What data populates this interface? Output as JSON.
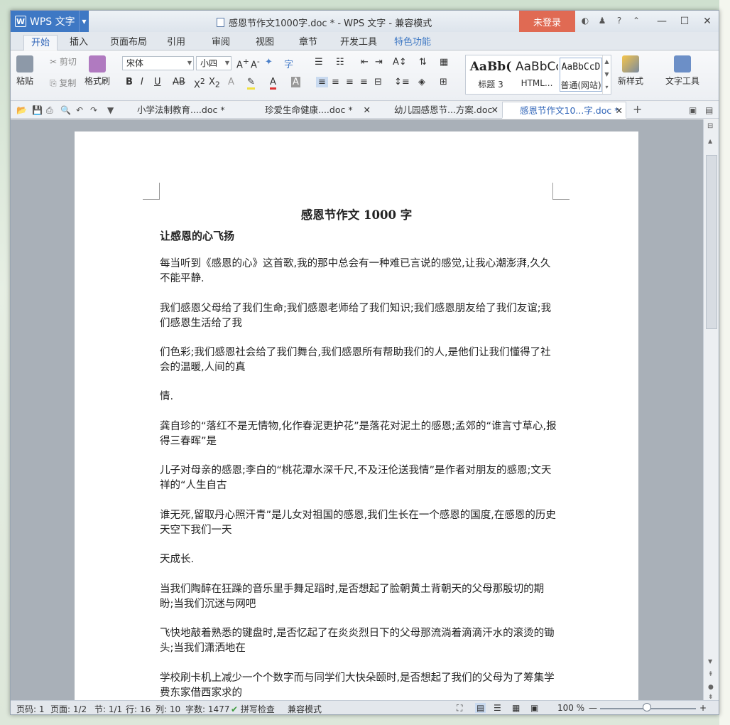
{
  "titlebar": {
    "app_name": "WPS 文字",
    "title": "感恩节作文1000字.doc * - WPS 文字 - 兼容模式",
    "login_label": "未登录"
  },
  "menu_tabs": [
    "开始",
    "插入",
    "页面布局",
    "引用",
    "审阅",
    "视图",
    "章节",
    "开发工具",
    "特色功能"
  ],
  "ribbon": {
    "paste": "粘贴",
    "cut": "剪切",
    "copy": "复制",
    "format_painter": "格式刷",
    "font_name": "宋体",
    "font_size": "小四",
    "styles": [
      {
        "preview": "AaBb(",
        "label": "标题 3"
      },
      {
        "preview": "AaBbCc",
        "label": "HTML..."
      },
      {
        "preview": "AaBbCcD",
        "label": "普通(网站)"
      }
    ],
    "new_style": "新样式",
    "text_tools": "文字工具"
  },
  "doc_tabs": [
    {
      "label": "小学法制教育....doc *"
    },
    {
      "label": "珍爱生命健康....doc *"
    },
    {
      "label": "幼儿园感恩节...方案.doc"
    },
    {
      "label": "感恩节作文10...字.doc *"
    }
  ],
  "document": {
    "title": "感恩节作文 1000 字",
    "subtitle": "让感恩的心飞扬",
    "paragraphs": [
      "每当听到《感恩的心》这首歌,我的那中总会有一种难已言说的感觉,让我心潮澎湃,久久不能平静.",
      "我们感恩父母给了我们生命;我们感恩老师给了我们知识;我们感恩朋友给了我们友谊;我们感恩生活给了我",
      "们色彩;我们感恩社会给了我们舞台,我们感恩所有帮助我们的人,是他们让我们懂得了社会的温暖,人间的真",
      "情.",
      "龚自珍的“落红不是无情物,化作春泥更护花”是落花对泥土的感恩;孟郊的“谁言寸草心,报得三春晖”是",
      "儿子对母亲的感恩;李白的“桃花潭水深千尺,不及汪伦送我情”是作者对朋友的感恩;文天祥的“人生自古",
      "谁无死,留取丹心照汗青”是儿女对祖国的感恩,我们生长在一个感恩的国度,在感恩的历史天空下我们一天",
      "天成长.",
      "当我们陶醉在狂躁的音乐里手舞足蹈时,是否想起了脸朝黄土背朝天的父母那殷切的期盼;当我们沉迷与网吧",
      "飞快地敲着熟悉的键盘时,是否忆起了在炎炎烈日下的父母那流淌着滴滴汗水的滚烫的锄头;当我们潇洒地在",
      "学校刷卡机上减少一个个数字而与同学们大快朵颐时,是否想起了我们的父母为了筹集学费东家借西家求的"
    ]
  },
  "statusbar": {
    "page_code": "页码: 1",
    "pages": "页面: 1/2",
    "section": "节: 1/1",
    "row": "行: 16",
    "col": "列: 10",
    "word_count": "字数: 1477",
    "spell_check": "拼写检查",
    "mode": "兼容模式",
    "zoom": "100 %"
  }
}
